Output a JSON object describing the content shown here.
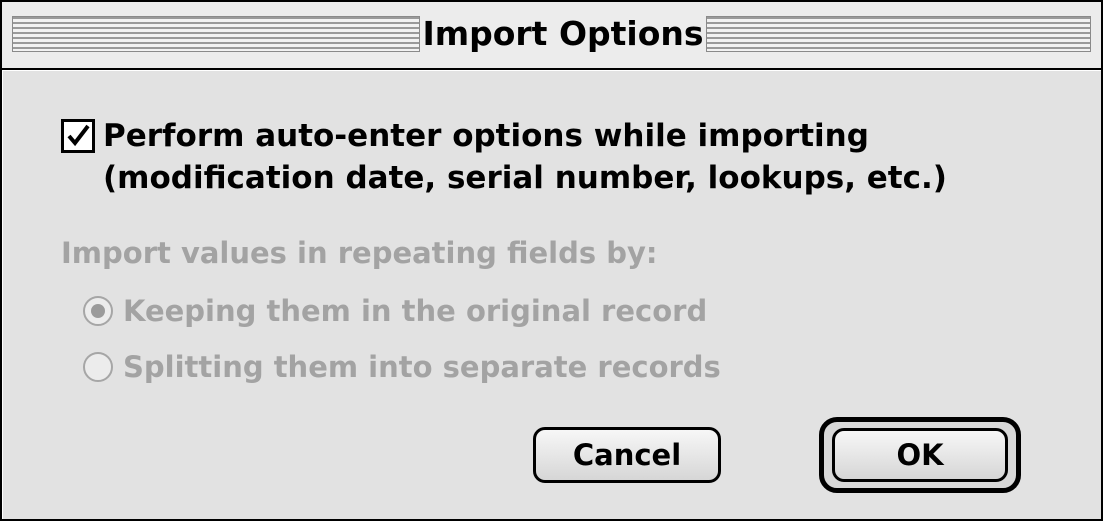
{
  "dialog": {
    "title": "Import Options",
    "auto_enter": {
      "checked": true,
      "line1": "Perform auto-enter options while importing",
      "line2": "(modification date, serial number, lookups, etc.)"
    },
    "repeating_fields": {
      "label": "Import values in repeating fields by:",
      "enabled": false,
      "options": [
        {
          "label": "Keeping them in the original record",
          "selected": true
        },
        {
          "label": "Splitting them into separate records",
          "selected": false
        }
      ]
    },
    "buttons": {
      "cancel": "Cancel",
      "ok": "OK",
      "default": "ok"
    }
  }
}
